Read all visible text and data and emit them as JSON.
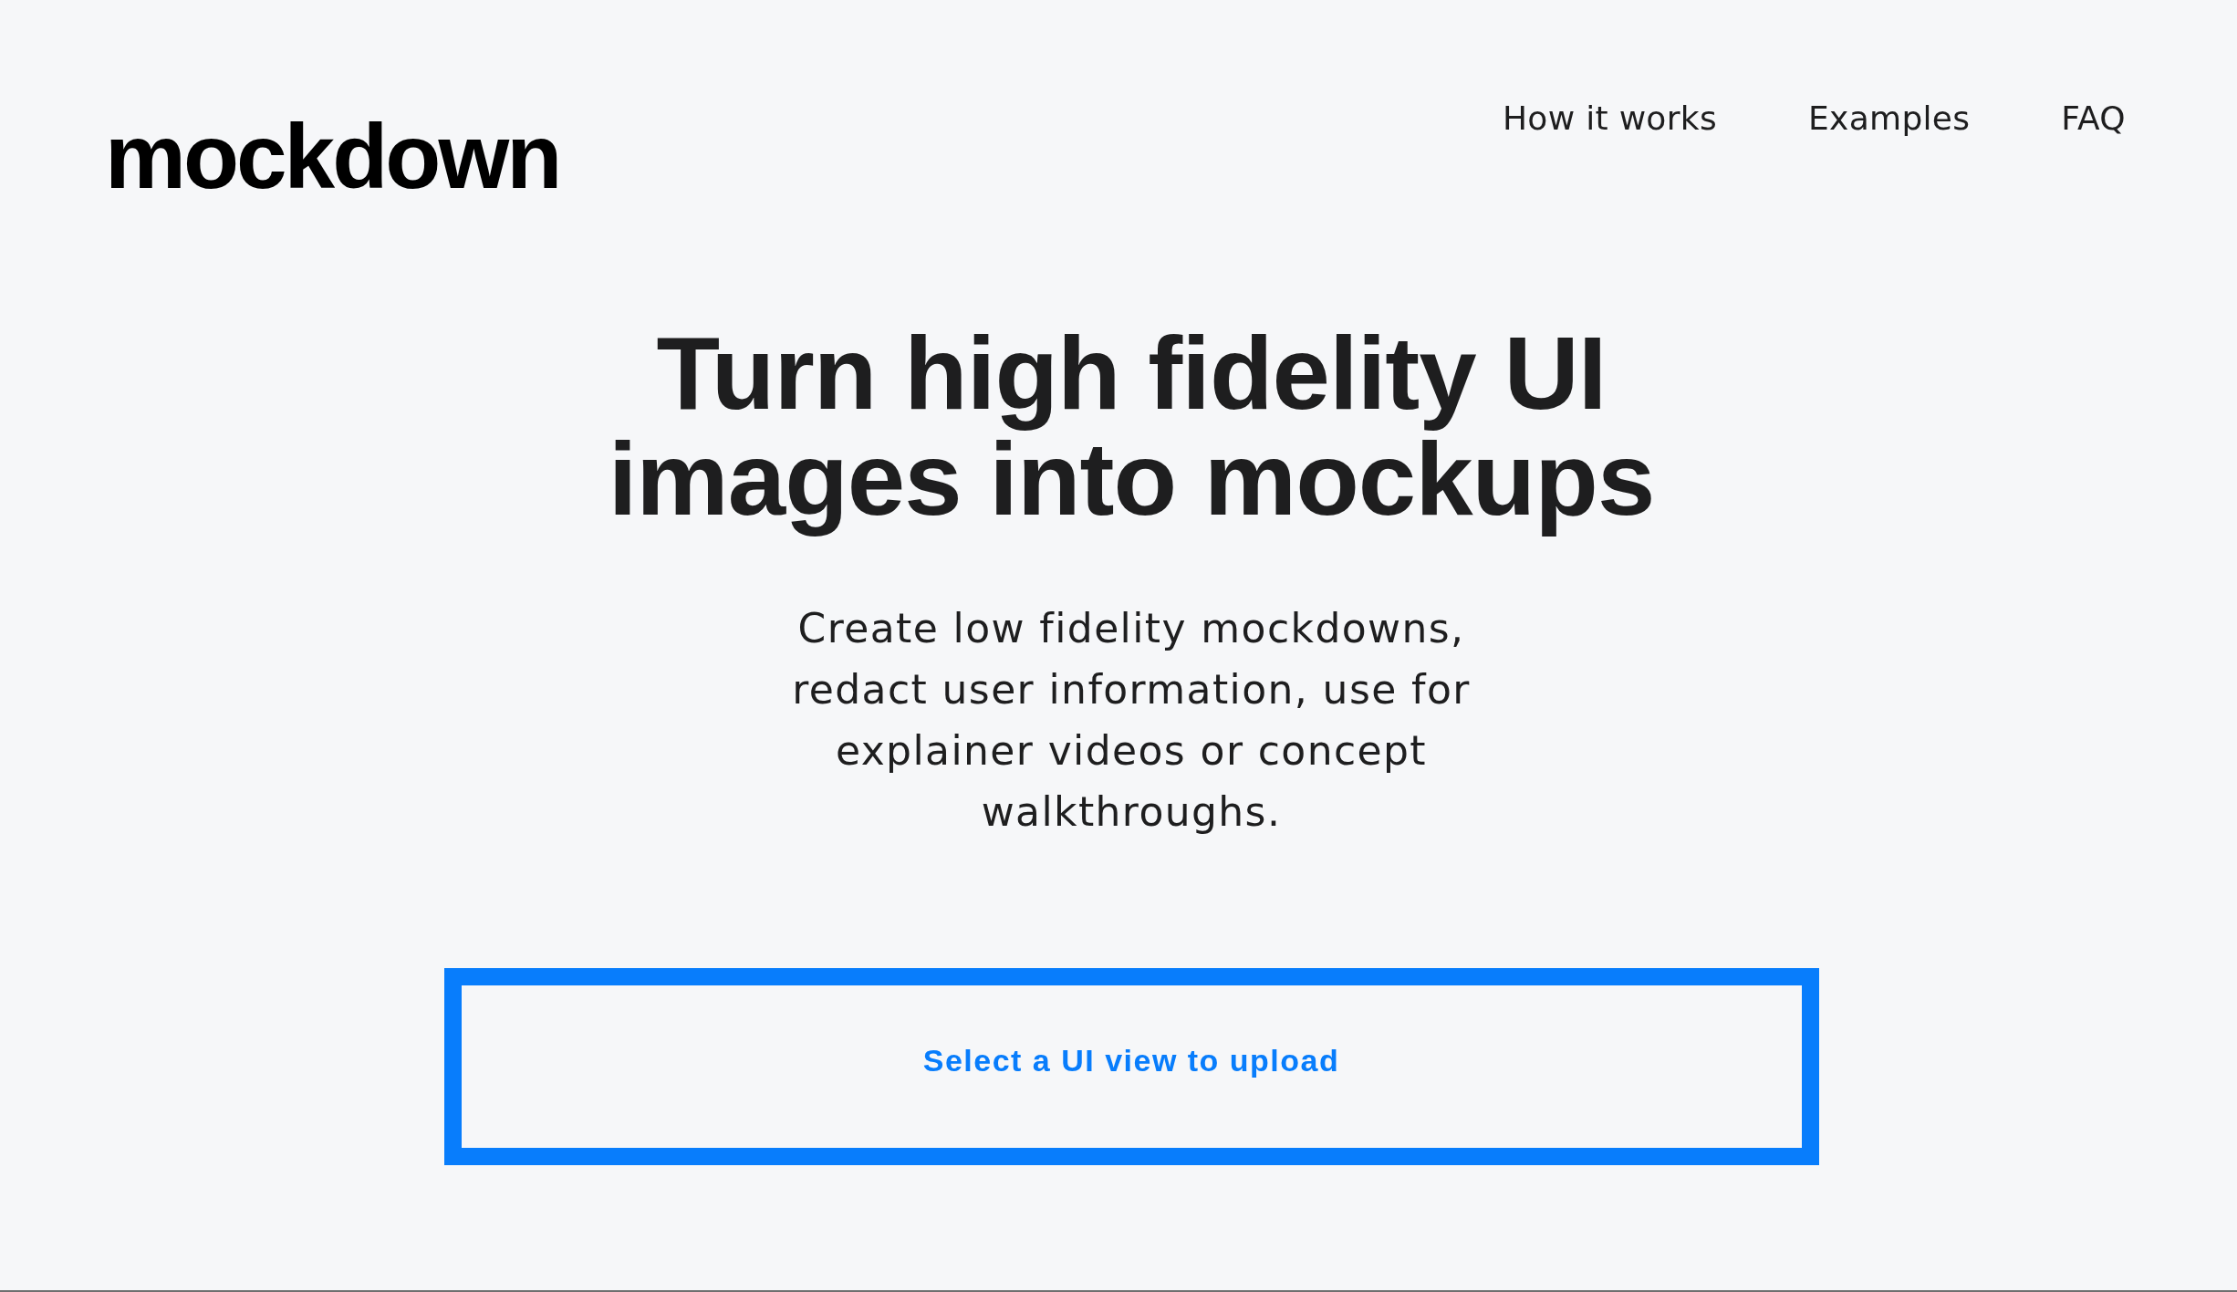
{
  "logo": {
    "text": "mockdown"
  },
  "nav": {
    "links": [
      "How it works",
      "Examples",
      "FAQ"
    ]
  },
  "hero": {
    "headline": "Turn high fidelity UI images into mockups",
    "subtitle": "Create low fidelity mockdowns, redact user information, use for explainer videos or concept walkthroughs."
  },
  "upload_button": {
    "label": "Select a UI view to upload"
  }
}
